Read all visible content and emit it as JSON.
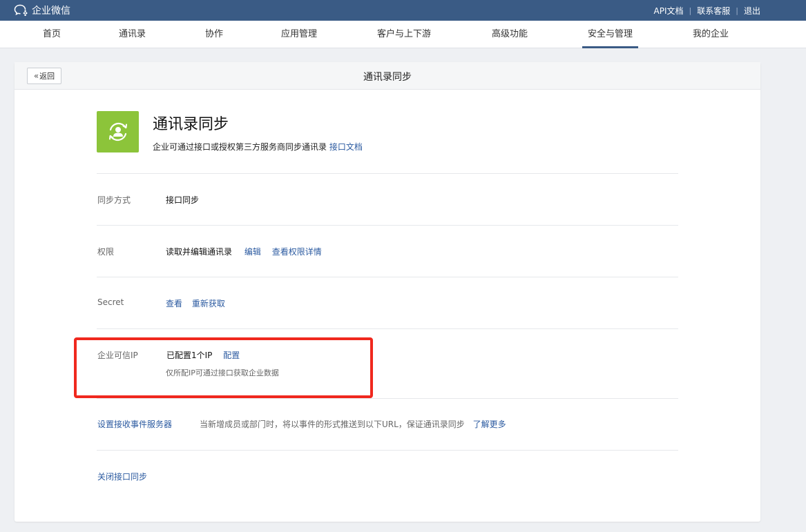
{
  "topbar": {
    "brand": "企业微信",
    "links": [
      "API文档",
      "联系客服",
      "退出"
    ]
  },
  "nav": {
    "items": [
      "首页",
      "通讯录",
      "协作",
      "应用管理",
      "客户与上下游",
      "高级功能",
      "安全与管理",
      "我的企业"
    ],
    "active": "安全与管理"
  },
  "panel": {
    "back_label": "返回",
    "title": "通讯录同步"
  },
  "app": {
    "name": "通讯录同步",
    "description": "企业可通过接口或授权第三方服务商同步通讯录",
    "doc_link": "接口文档",
    "icon": "sync-user-icon",
    "icon_color": "#8cc43a"
  },
  "rows": {
    "sync_mode": {
      "label": "同步方式",
      "value": "接口同步"
    },
    "permission": {
      "label": "权限",
      "value": "读取并编辑通讯录",
      "edit_link": "编辑",
      "detail_link": "查看权限详情"
    },
    "secret": {
      "label": "Secret",
      "view_link": "查看",
      "refresh_link": "重新获取"
    },
    "trusted_ip": {
      "label": "企业可信IP",
      "value": "已配置1个IP",
      "config_link": "配置",
      "hint": "仅所配IP可通过接口获取企业数据"
    }
  },
  "event_server": {
    "link": "设置接收事件服务器",
    "description": "当新增成员或部门时，将以事件的形式推送到以下URL，保证通讯录同步",
    "more_link": "了解更多"
  },
  "close_sync": "关闭接口同步",
  "colors": {
    "header_bg": "#3a5b85",
    "link": "#2b5aa0",
    "highlight": "#f0281e"
  }
}
